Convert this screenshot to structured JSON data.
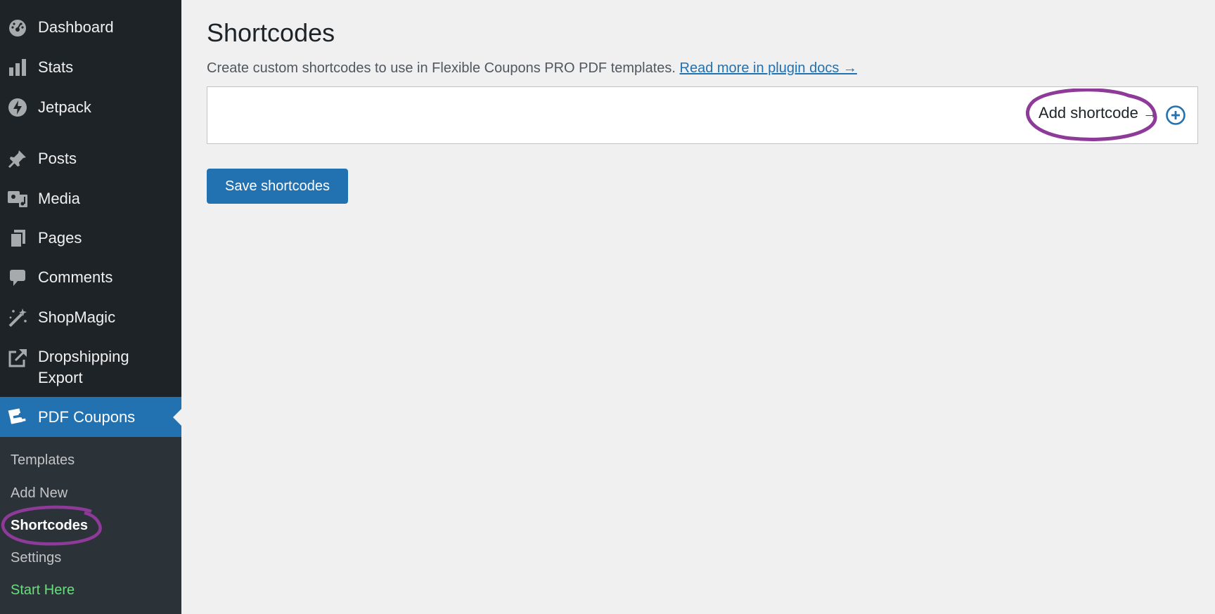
{
  "sidebar": {
    "items": [
      {
        "label": "Dashboard",
        "icon": "dashboard-icon"
      },
      {
        "label": "Stats",
        "icon": "stats-icon"
      },
      {
        "label": "Jetpack",
        "icon": "jetpack-icon"
      },
      {
        "label": "Posts",
        "icon": "pin-icon"
      },
      {
        "label": "Media",
        "icon": "media-icon"
      },
      {
        "label": "Pages",
        "icon": "pages-icon"
      },
      {
        "label": "Comments",
        "icon": "comment-icon"
      },
      {
        "label": "ShopMagic",
        "icon": "magic-wand-icon"
      },
      {
        "label_line1": "Dropshipping",
        "label_line2": "Export",
        "icon": "external-link-icon"
      },
      {
        "label": "PDF Coupons",
        "icon": "coupons-icon"
      }
    ],
    "submenu": [
      {
        "label": "Templates"
      },
      {
        "label": "Add New"
      },
      {
        "label": "Shortcodes"
      },
      {
        "label": "Settings"
      },
      {
        "label": "Start Here"
      }
    ]
  },
  "main": {
    "title": "Shortcodes",
    "description": "Create custom shortcodes to use in Flexible Coupons PRO PDF templates.",
    "docs_link": "Read more in plugin docs →",
    "add_shortcode_label": "Add shortcode →",
    "save_button": "Save shortcodes"
  },
  "colors": {
    "sidebar_bg": "#1d2327",
    "submenu_bg": "#2c3338",
    "accent": "#2271b1",
    "start_here": "#68de7c",
    "annotation": "#8e3a99"
  }
}
